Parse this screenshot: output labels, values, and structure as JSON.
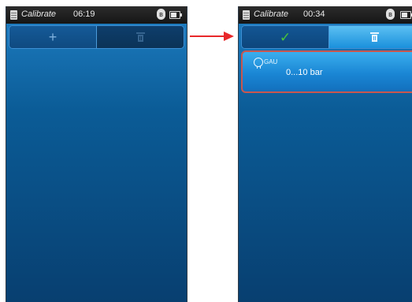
{
  "screens": [
    {
      "status": {
        "app_title": "Calibrate",
        "time": "06:19"
      },
      "toolbar": {
        "left_icon": "plus-icon",
        "left_symbol": "+",
        "right_icon": "trash-icon"
      }
    },
    {
      "status": {
        "app_title": "Calibrate",
        "time": "00:34"
      },
      "toolbar": {
        "left_icon": "check-icon",
        "left_symbol": "✓",
        "right_icon": "trash-icon"
      },
      "device": {
        "icon": "bulb-icon",
        "type": "GAU",
        "range": "0...10 bar"
      }
    }
  ],
  "status_icons": {
    "bluetooth": "bluetooth-icon",
    "bluetooth_symbol": "ʙ",
    "battery": "battery-icon"
  },
  "annotation": {
    "arrow_icon": "right-arrow-icon",
    "color": "#e8282a"
  },
  "colors": {
    "background_top": "#1f7fc4",
    "background_bottom": "#083f70",
    "highlight_border": "#c9574f",
    "check": "#4ac43a"
  }
}
